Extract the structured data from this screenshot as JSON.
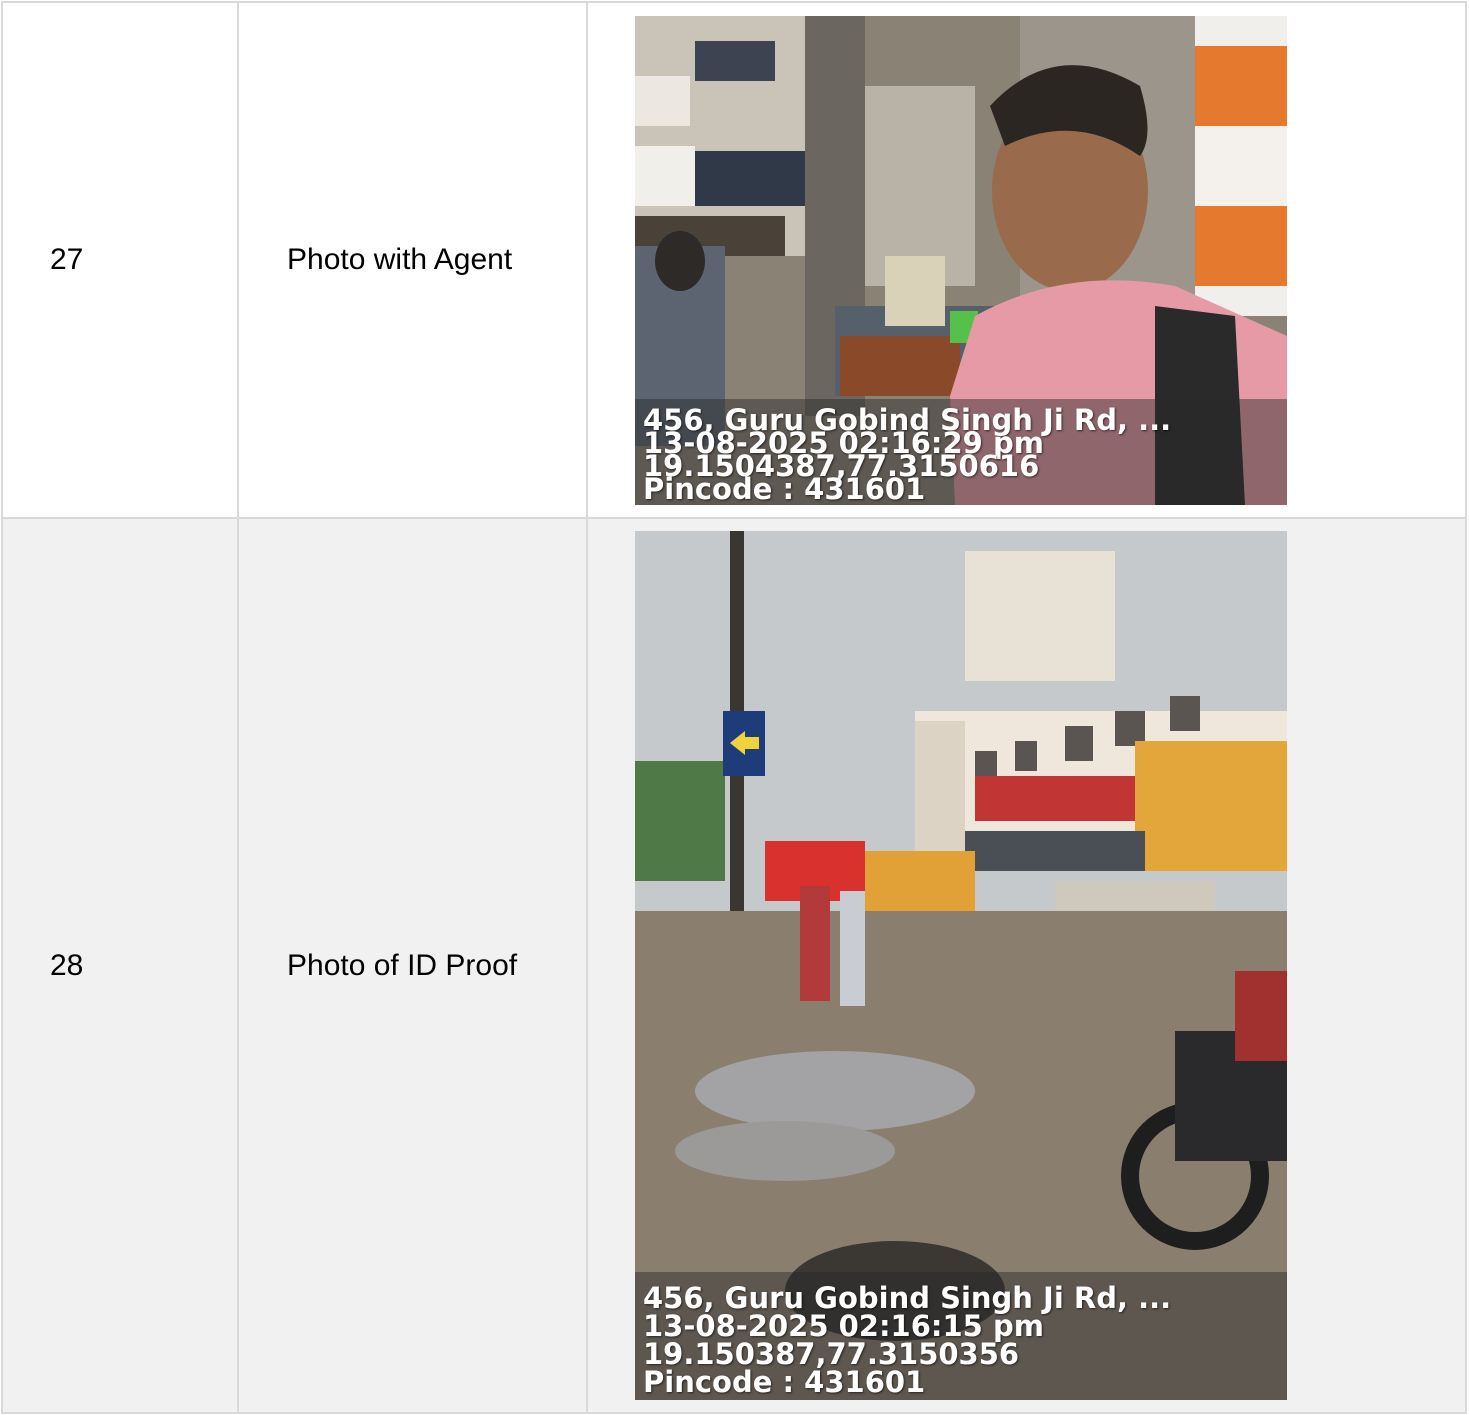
{
  "rows": [
    {
      "number": "27",
      "label": "Photo with Agent",
      "photo_alt": "selfie-street-photo",
      "stamp": {
        "address": "456, Guru Gobind Singh Ji Rd, ...",
        "datetime": "13-08-2025 02:16:29 pm",
        "coords": "19.1504387,77.3150616",
        "pincode": "Pincode : 431601"
      }
    },
    {
      "number": "28",
      "label": "Photo of ID Proof",
      "photo_alt": "street-scene-photo",
      "stamp": {
        "address": "456, Guru Gobind Singh Ji Rd, ...",
        "datetime": "13-08-2025 02:16:15 pm",
        "coords": "19.150387,77.3150356",
        "pincode": "Pincode : 431601"
      }
    }
  ]
}
